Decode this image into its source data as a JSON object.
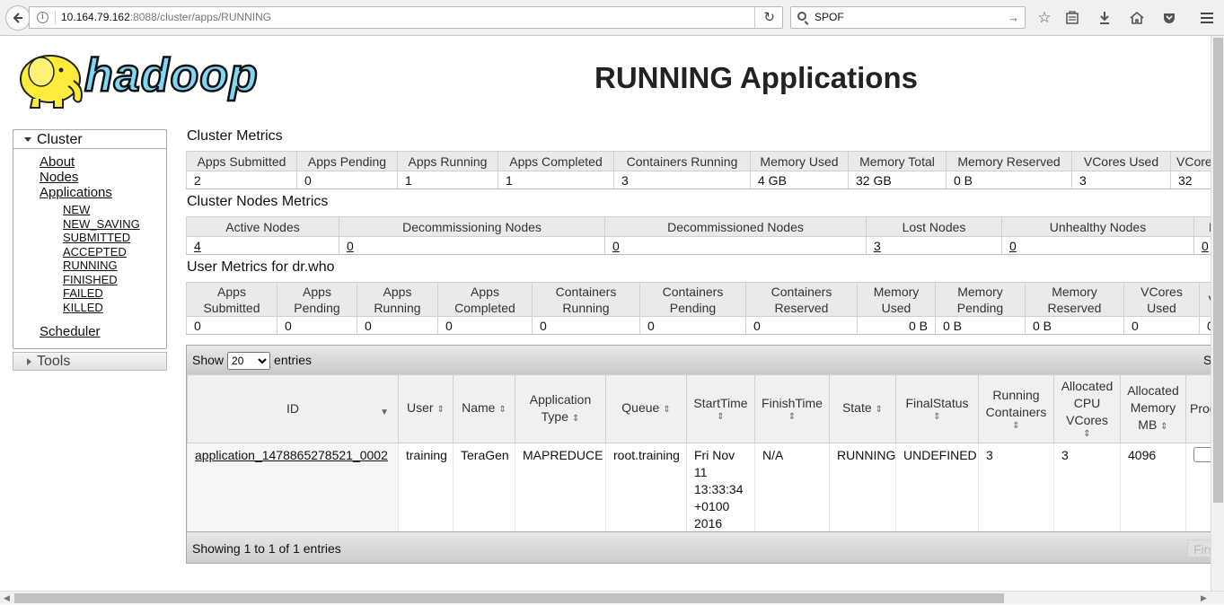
{
  "browser": {
    "url_host": "10.164.79.162",
    "url_rest": ":8088/cluster/apps/RUNNING",
    "search_value": "SPOF"
  },
  "page": {
    "logo_text": "hadoop",
    "title": "RUNNING Applications"
  },
  "nav": {
    "cluster_label": "Cluster",
    "about": "About",
    "nodes": "Nodes",
    "applications": "Applications",
    "states": [
      "NEW",
      "NEW_SAVING",
      "SUBMITTED",
      "ACCEPTED",
      "RUNNING",
      "FINISHED",
      "FAILED",
      "KILLED"
    ],
    "scheduler": "Scheduler",
    "tools_label": "Tools"
  },
  "cluster_metrics": {
    "title": "Cluster Metrics",
    "headers": [
      "Apps Submitted",
      "Apps Pending",
      "Apps Running",
      "Apps Completed",
      "Containers Running",
      "Memory Used",
      "Memory Total",
      "Memory Reserved",
      "VCores Used",
      "VCores Total"
    ],
    "values": [
      "2",
      "0",
      "1",
      "1",
      "3",
      "4 GB",
      "32 GB",
      "0 B",
      "3",
      "32"
    ]
  },
  "nodes_metrics": {
    "title": "Cluster Nodes Metrics",
    "headers": [
      "Active Nodes",
      "Decommissioning Nodes",
      "Decommissioned Nodes",
      "Lost Nodes",
      "Unhealthy Nodes",
      "Rebooted Nodes"
    ],
    "values": [
      "4",
      "0",
      "0",
      "3",
      "0",
      "0"
    ]
  },
  "user_metrics": {
    "title": "User Metrics for dr.who",
    "headers": [
      "Apps Submitted",
      "Apps Pending",
      "Apps Running",
      "Apps Completed",
      "Containers Running",
      "Containers Pending",
      "Containers Reserved",
      "Memory Used",
      "Memory Pending",
      "Memory Reserved",
      "VCores Used",
      "VCores Pending"
    ],
    "values": [
      "0",
      "0",
      "0",
      "0",
      "0",
      "0",
      "0",
      "0 B",
      "0 B",
      "0 B",
      "0",
      "0"
    ]
  },
  "apps": {
    "show_label": "Show",
    "entries_label": "entries",
    "page_size": "20",
    "search_label": "Search:",
    "columns": [
      "ID",
      "User",
      "Name",
      "Application Type",
      "Queue",
      "StartTime",
      "FinishTime",
      "State",
      "FinalStatus",
      "Running Containers",
      "Allocated CPU VCores",
      "Allocated Memory MB",
      "Progress"
    ],
    "rows": [
      {
        "id": "application_1478865278521_0002",
        "user": "training",
        "name": "TeraGen",
        "type": "MAPREDUCE",
        "queue": "root.training",
        "start_time": "Fri Nov 11 13:33:34 +0100 2016",
        "finish_time": "N/A",
        "state": "RUNNING",
        "final_status": "UNDEFINED",
        "running_containers": "3",
        "vcores": "3",
        "memory_mb": "4096"
      }
    ],
    "info": "Showing 1 to 1 of 1 entries",
    "first_label": "First"
  }
}
